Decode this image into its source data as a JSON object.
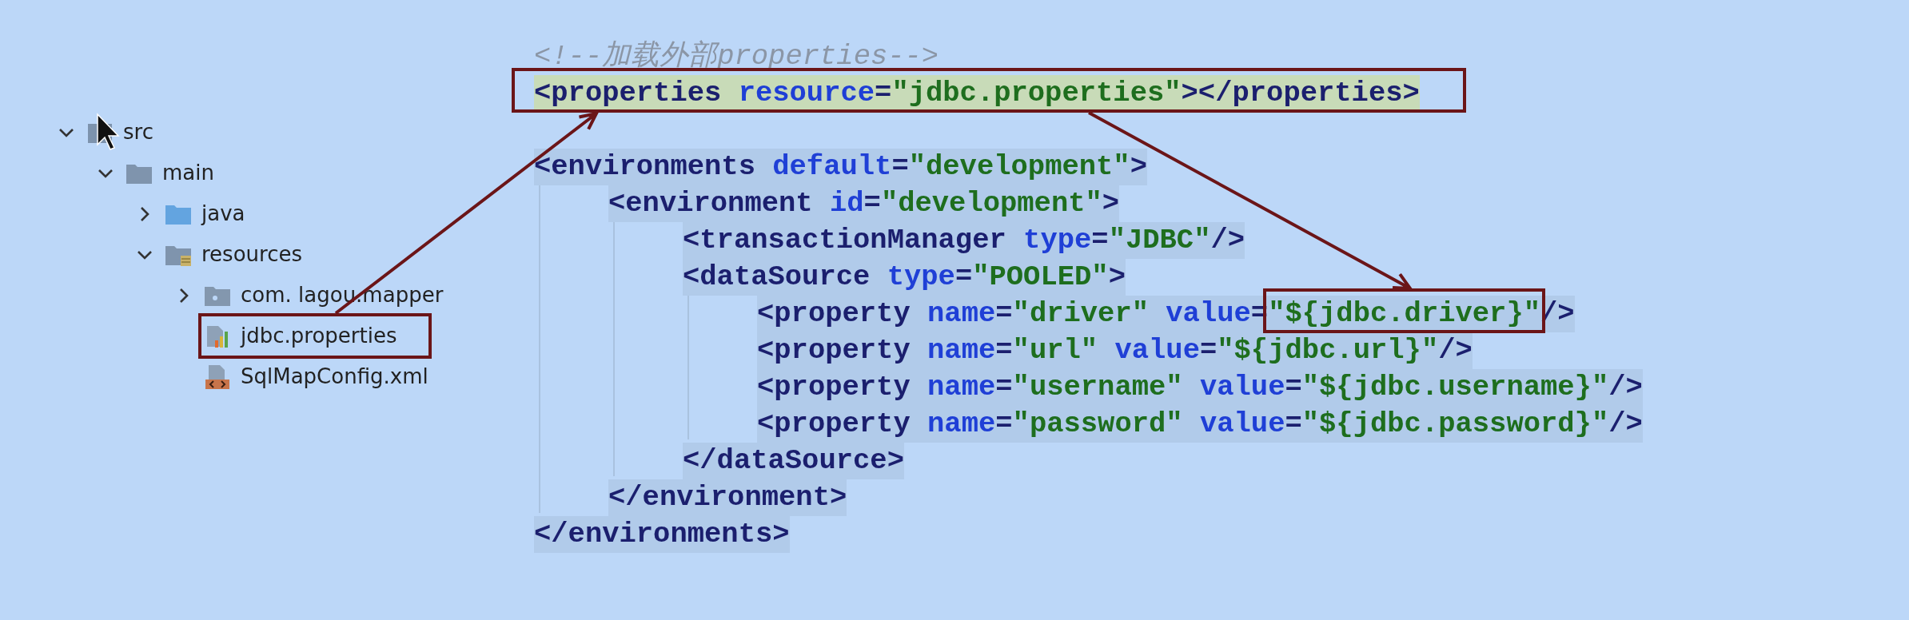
{
  "tree": [
    {
      "label": "src",
      "kind": "source-root",
      "expanded": true,
      "children": [
        {
          "label": "main",
          "kind": "folder",
          "expanded": true,
          "children": [
            {
              "label": "java",
              "kind": "source-folder",
              "expanded": false
            },
            {
              "label": "resources",
              "kind": "resource-folder",
              "expanded": true,
              "children": [
                {
                  "label": "com. lagou.mapper",
                  "kind": "package",
                  "expanded": false
                },
                {
                  "label": "jdbc.properties",
                  "kind": "properties-file"
                },
                {
                  "label": "SqlMapConfig.xml",
                  "kind": "xml-file"
                }
              ]
            }
          ]
        }
      ]
    }
  ],
  "code": [
    {
      "kind": "comment",
      "tokens": [
        {
          "kind": "comment",
          "text": "<!--加载外部properties-->"
        }
      ]
    },
    {
      "kind": "element",
      "highlighted": true,
      "tokens": [
        {
          "kind": "tag",
          "text": "<properties"
        },
        {
          "kind": "attr",
          "text": " resource"
        },
        {
          "kind": "punct",
          "text": "="
        },
        {
          "kind": "value",
          "text": "\"jdbc.properties\""
        },
        {
          "kind": "tag",
          "text": "></properties>"
        }
      ]
    },
    {
      "kind": "element",
      "highlighted": false,
      "tokens": [
        {
          "kind": "tag",
          "text": "<environments"
        },
        {
          "kind": "attr",
          "text": " default"
        },
        {
          "kind": "punct",
          "text": "="
        },
        {
          "kind": "value",
          "text": "\"development\""
        },
        {
          "kind": "tag",
          "text": ">"
        }
      ],
      "children": [
        {
          "kind": "element",
          "highlighted": false,
          "tokens": [
            {
              "kind": "tag",
              "text": "<environment"
            },
            {
              "kind": "attr",
              "text": " id"
            },
            {
              "kind": "punct",
              "text": "="
            },
            {
              "kind": "value",
              "text": "\"development\""
            },
            {
              "kind": "tag",
              "text": ">"
            }
          ],
          "children": [
            {
              "kind": "element",
              "highlighted": false,
              "tokens": [
                {
                  "kind": "tag",
                  "text": "<transactionManager"
                },
                {
                  "kind": "attr",
                  "text": " type"
                },
                {
                  "kind": "punct",
                  "text": "="
                },
                {
                  "kind": "value",
                  "text": "\"JDBC\""
                },
                {
                  "kind": "tag",
                  "text": "/>"
                }
              ]
            },
            {
              "kind": "element",
              "highlighted": false,
              "tokens": [
                {
                  "kind": "tag",
                  "text": "<dataSource"
                },
                {
                  "kind": "attr",
                  "text": " type"
                },
                {
                  "kind": "punct",
                  "text": "="
                },
                {
                  "kind": "value",
                  "text": "\"POOLED\""
                },
                {
                  "kind": "tag",
                  "text": ">"
                }
              ],
              "children": [
                {
                  "kind": "element",
                  "highlighted": false,
                  "tokens": [
                    {
                      "kind": "tag",
                      "text": "<property"
                    },
                    {
                      "kind": "attr",
                      "text": " name"
                    },
                    {
                      "kind": "punct",
                      "text": "="
                    },
                    {
                      "kind": "value",
                      "text": "\"driver\""
                    },
                    {
                      "kind": "attr",
                      "text": " value"
                    },
                    {
                      "kind": "punct",
                      "text": "="
                    },
                    {
                      "kind": "value",
                      "text": "\"${jdbc.driver}\""
                    },
                    {
                      "kind": "tag",
                      "text": "/>"
                    }
                  ]
                },
                {
                  "kind": "element",
                  "highlighted": false,
                  "tokens": [
                    {
                      "kind": "tag",
                      "text": "<property"
                    },
                    {
                      "kind": "attr",
                      "text": " name"
                    },
                    {
                      "kind": "punct",
                      "text": "="
                    },
                    {
                      "kind": "value",
                      "text": "\"url\""
                    },
                    {
                      "kind": "attr",
                      "text": " value"
                    },
                    {
                      "kind": "punct",
                      "text": "="
                    },
                    {
                      "kind": "value",
                      "text": "\"${jdbc.url}\""
                    },
                    {
                      "kind": "tag",
                      "text": "/>"
                    }
                  ]
                },
                {
                  "kind": "element",
                  "highlighted": false,
                  "tokens": [
                    {
                      "kind": "tag",
                      "text": "<property"
                    },
                    {
                      "kind": "attr",
                      "text": " name"
                    },
                    {
                      "kind": "punct",
                      "text": "="
                    },
                    {
                      "kind": "value",
                      "text": "\"username\""
                    },
                    {
                      "kind": "attr",
                      "text": " value"
                    },
                    {
                      "kind": "punct",
                      "text": "="
                    },
                    {
                      "kind": "value",
                      "text": "\"${jdbc.username}\""
                    },
                    {
                      "kind": "tag",
                      "text": "/>"
                    }
                  ]
                },
                {
                  "kind": "element",
                  "highlighted": false,
                  "tokens": [
                    {
                      "kind": "tag",
                      "text": "<property"
                    },
                    {
                      "kind": "attr",
                      "text": " name"
                    },
                    {
                      "kind": "punct",
                      "text": "="
                    },
                    {
                      "kind": "value",
                      "text": "\"password\""
                    },
                    {
                      "kind": "attr",
                      "text": " value"
                    },
                    {
                      "kind": "punct",
                      "text": "="
                    },
                    {
                      "kind": "value",
                      "text": "\"${jdbc.password}\""
                    },
                    {
                      "kind": "tag",
                      "text": "/>"
                    }
                  ]
                }
              ],
              "closing": "</dataSource>"
            }
          ],
          "closing": "</environment>"
        }
      ],
      "closing": "</environments>"
    }
  ]
}
